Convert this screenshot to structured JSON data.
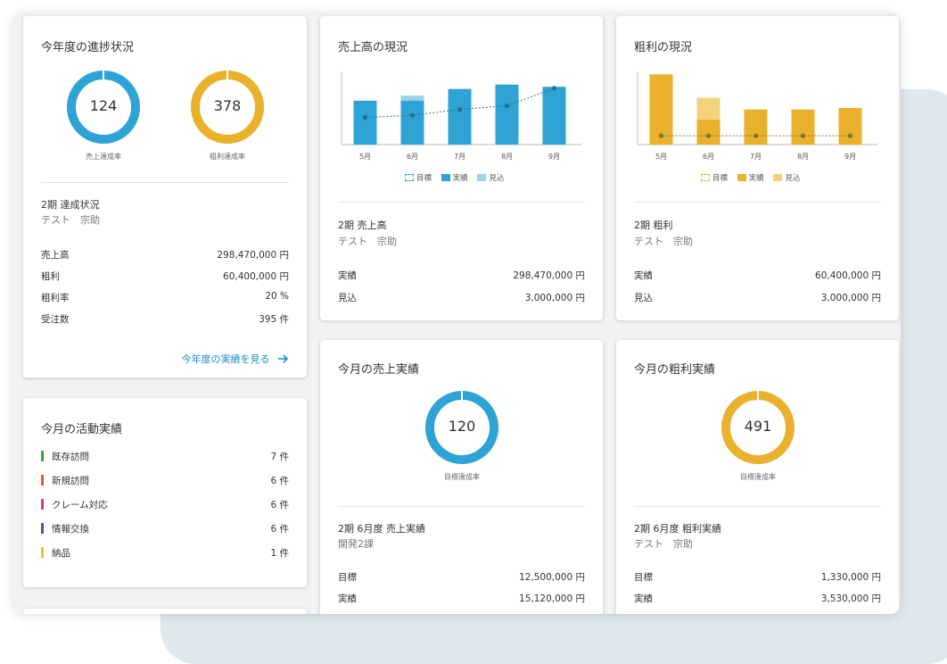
{
  "progress": {
    "title": "今年度の進捗状況",
    "sales_rate": {
      "value": "124",
      "caption": "売上達成率",
      "color": "#2ea3d6",
      "percent": 100
    },
    "profit_rate": {
      "value": "378",
      "caption": "粗利達成率",
      "color": "#e9b12c",
      "percent": 100
    },
    "period_label": "2期 達成状況",
    "user": "テスト　宗助",
    "rows": [
      {
        "label": "売上高",
        "value": "298,470,000 円"
      },
      {
        "label": "粗利",
        "value": "60,400,000 円"
      },
      {
        "label": "粗利率",
        "value": "20 %"
      },
      {
        "label": "受注数",
        "value": "395 件"
      }
    ],
    "link": "今年度の実績を見る",
    "link_icon": "arrow-right-icon"
  },
  "activity": {
    "title": "今月の活動実績",
    "items": [
      {
        "label": "既存訪問",
        "value": "7 件",
        "color": "#43a047"
      },
      {
        "label": "新規訪問",
        "value": "6 件",
        "color": "#e8573a"
      },
      {
        "label": "クレーム対応",
        "value": "6 件",
        "color": "#d63a7a"
      },
      {
        "label": "情報交換",
        "value": "6 件",
        "color": "#7b3fa0"
      },
      {
        "label": "納品",
        "value": "1 件",
        "color": "#e9c22c"
      }
    ]
  },
  "sales_status": {
    "title": "売上高の現況",
    "legend": {
      "target": "目標",
      "actual": "実績",
      "forecast": "見込"
    },
    "period_label": "2期 売上高",
    "user": "テスト　宗助",
    "rows": [
      {
        "label": "実績",
        "value": "298,470,000 円"
      },
      {
        "label": "見込",
        "value": "3,000,000 円"
      }
    ]
  },
  "profit_status": {
    "title": "粗利の現況",
    "legend": {
      "target": "目標",
      "actual": "実績",
      "forecast": "見込"
    },
    "period_label": "2期 粗利",
    "user": "テスト　宗助",
    "rows": [
      {
        "label": "実績",
        "value": "60,400,000 円"
      },
      {
        "label": "見込",
        "value": "3,000,000 円"
      }
    ]
  },
  "month_sales": {
    "title": "今月の売上実績",
    "rate": {
      "value": "120",
      "caption": "目標達成率",
      "color": "#2ea3d6",
      "percent": 100
    },
    "period_label": "2期 6月度 売上実績",
    "user": "開発2課",
    "rows": [
      {
        "label": "目標",
        "value": "12,500,000 円"
      },
      {
        "label": "実績",
        "value": "15,120,000 円"
      }
    ]
  },
  "month_profit": {
    "title": "今月の粗利実績",
    "rate": {
      "value": "491",
      "caption": "目標達成率",
      "color": "#e9b12c",
      "percent": 100
    },
    "period_label": "2期 6月度 粗利実績",
    "user": "テスト　宗助",
    "rows": [
      {
        "label": "目標",
        "value": "1,330,000 円"
      },
      {
        "label": "実績",
        "value": "3,530,000 円"
      }
    ]
  },
  "chart_data": [
    {
      "type": "bar",
      "categories": [
        "5月",
        "6月",
        "7月",
        "8月",
        "9月"
      ],
      "ylim": [
        0,
        100
      ],
      "grid": false,
      "legend_position": "bottom",
      "colors": {
        "actual": "#2ea3d6",
        "forecast": "#9fd2ea",
        "target": "#2a6f8c"
      },
      "series": [
        {
          "name": "実績",
          "values": [
            60,
            60,
            76,
            82,
            79
          ]
        },
        {
          "name": "見込",
          "values": [
            0,
            7,
            0,
            0,
            0
          ]
        },
        {
          "name": "目標",
          "values": [
            37,
            40,
            48,
            53,
            77
          ]
        }
      ]
    },
    {
      "type": "bar",
      "categories": [
        "5月",
        "6月",
        "7月",
        "8月",
        "9月"
      ],
      "ylim": [
        0,
        100
      ],
      "grid": false,
      "legend_position": "bottom",
      "colors": {
        "actual": "#e9b12c",
        "forecast": "#f3d27c",
        "target": "#7a7a2a"
      },
      "series": [
        {
          "name": "実績",
          "values": [
            96,
            34,
            48,
            48,
            50
          ]
        },
        {
          "name": "見込",
          "values": [
            0,
            30,
            0,
            0,
            0
          ]
        },
        {
          "name": "目標",
          "values": [
            12,
            12,
            12,
            12,
            12
          ]
        }
      ]
    }
  ]
}
